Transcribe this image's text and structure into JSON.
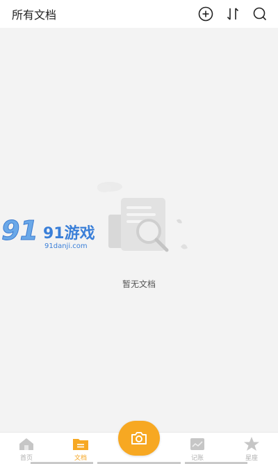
{
  "header": {
    "title": "所有文档",
    "icons": [
      "add-circle-icon",
      "sort-icon",
      "search-icon"
    ]
  },
  "empty_state": {
    "message": "暂无文档",
    "illustration": "document-search-illustration"
  },
  "watermark": {
    "brand": "91游戏",
    "site": "91danji.com"
  },
  "tabbar": {
    "tabs": [
      {
        "label": "首页",
        "icon": "home-icon",
        "active": false
      },
      {
        "label": "文档",
        "icon": "folder-icon",
        "active": true
      },
      {
        "label": "记账",
        "icon": "ledger-icon",
        "active": false
      },
      {
        "label": "星座",
        "icon": "star-icon",
        "active": false
      }
    ],
    "center_action": "camera-icon"
  },
  "colors": {
    "accent": "#f7a822",
    "inactive": "#b0b0b0",
    "background": "#f3f3f3"
  }
}
